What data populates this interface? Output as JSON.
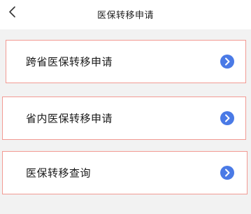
{
  "header": {
    "title": "医保转移申请"
  },
  "menu": {
    "items": [
      {
        "label": "跨省医保转移申请"
      },
      {
        "label": "省内医保转移申请"
      },
      {
        "label": "医保转移查询"
      }
    ]
  },
  "colors": {
    "accent_blue": "#4a7ae6",
    "item_border": "#f29a93",
    "page_background": "#f2f2f2"
  },
  "icons": {
    "back": "chevron-left-icon",
    "item_arrow": "chevron-right-circle-icon"
  }
}
